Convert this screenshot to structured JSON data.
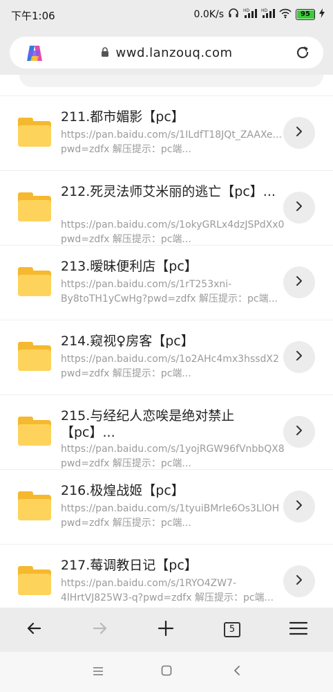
{
  "status_bar": {
    "time": "下午1:06",
    "net_speed": "0.0K/s",
    "battery": "95",
    "battery_level": 0.95
  },
  "address_bar": {
    "url": "wwd.lanzouq.com"
  },
  "items": [
    {
      "title": "211.都市媚影【pc】",
      "link": "https://pan.baidu.com/s/1ILdfT18JQt_ZAAXe...",
      "hint": "pwd=zdfx 解压提示：pc端..."
    },
    {
      "title": "212.死灵法师艾米丽的逃亡【pc】...",
      "link": "https://pan.baidu.com/s/1okyGRLx4dzJSPdXx0",
      "hint": "pwd=zdfx 解压提示：pc端..."
    },
    {
      "title": "213.暧昧便利店【pc】",
      "link": "https://pan.baidu.com/s/1rT253xni-",
      "hint": "By8toTH1yCwHg?pwd=zdfx 解压提示：pc端..."
    },
    {
      "title": "214.窥视♀房客【pc】",
      "link": "https://pan.baidu.com/s/1o2AHc4mx3hssdX2",
      "hint": "pwd=zdfx 解压提示：pc端..."
    },
    {
      "title": "215.与经纪人恋唉是绝对禁止【pc】...",
      "link": "https://pan.baidu.com/s/1yojRGW96fVnbbQX8",
      "hint": "pwd=zdfx 解压提示：pc端..."
    },
    {
      "title": "216.极煌战姬【pc】",
      "link": "https://pan.baidu.com/s/1tyuiBMrIe6Os3LlOH",
      "hint": "pwd=zdfx 解压提示：pc端..."
    },
    {
      "title": "217.莓调教日记【pc】",
      "link": "https://pan.baidu.com/s/1RYO4ZW7-",
      "hint": "4lHrtVJ825W3-q?pwd=zdfx 解压提示：pc端..."
    }
  ],
  "toolbar": {
    "tab_count": "5"
  },
  "colors": {
    "folder_dark": "#f5b82e",
    "folder_light": "#fdd35b",
    "toolbar_bg": "#ececec"
  }
}
